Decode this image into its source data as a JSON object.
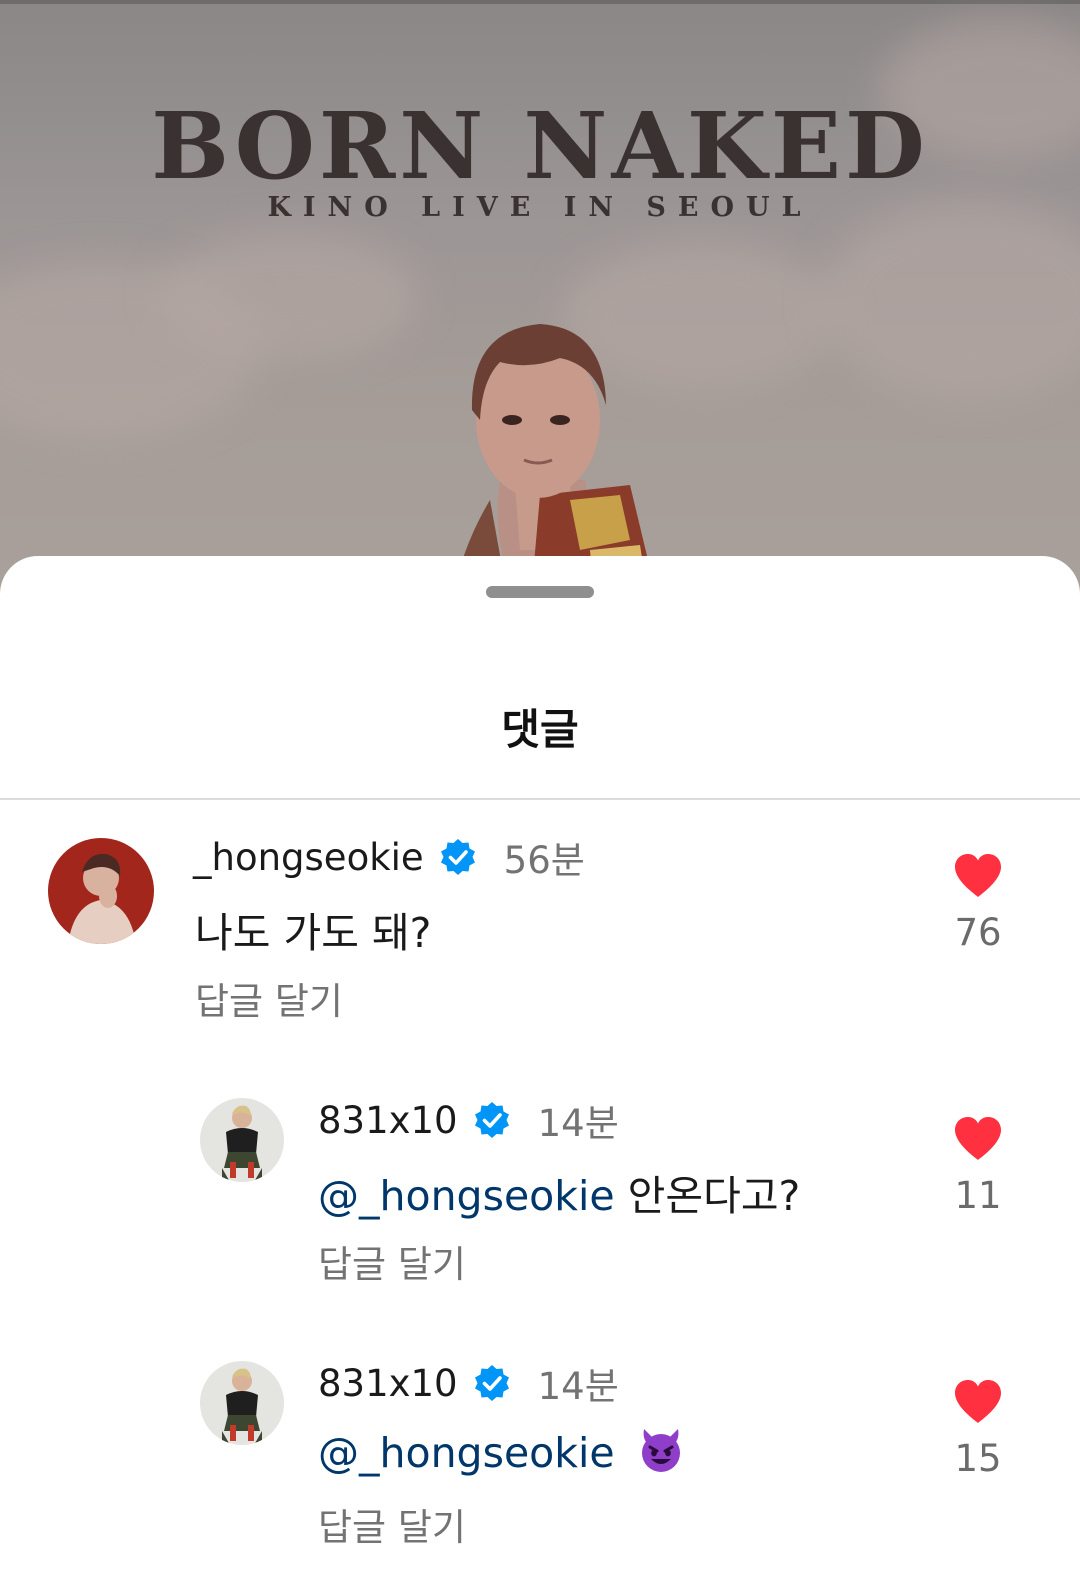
{
  "poster": {
    "title": "BORN NAKED",
    "subtitle": "KINO LIVE IN SEOUL"
  },
  "sheet": {
    "title": "댓글"
  },
  "comments": [
    {
      "username": "_hongseokie",
      "verified": true,
      "time": "56분",
      "mention": "",
      "text": "나도 가도 돼?",
      "reply_label": "답글 달기",
      "likes": "76"
    },
    {
      "username": "831x10",
      "verified": true,
      "time": "14분",
      "mention": "@_hongseokie",
      "text": "안온다고?",
      "reply_label": "답글 달기",
      "likes": "11"
    },
    {
      "username": "831x10",
      "verified": true,
      "time": "14분",
      "mention": "@_hongseokie",
      "text": "",
      "emoji": "smiling-devil",
      "reply_label": "답글 달기",
      "likes": "15"
    }
  ],
  "colors": {
    "heart": "#ff3040",
    "verified": "#0095f6",
    "mention": "#00376b"
  }
}
